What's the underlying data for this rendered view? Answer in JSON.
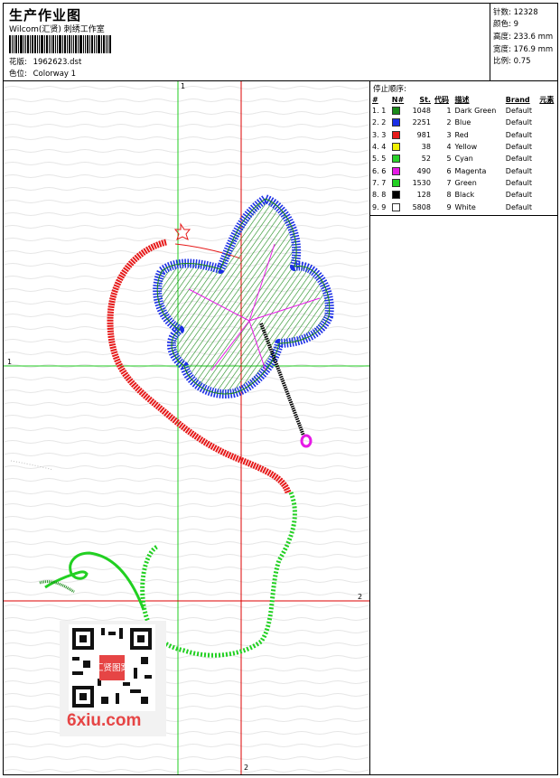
{
  "header": {
    "title": "生产作业图",
    "subtitle": "Wilcom(汇贤) 刺绣工作室",
    "design_label": "花版:",
    "design_value": "1962623.dst",
    "colorway_label": "色位:",
    "colorway_value": "Colorway 1"
  },
  "stats": [
    {
      "label": "针数:",
      "value": "12328"
    },
    {
      "label": "颜色:",
      "value": "9"
    },
    {
      "label": "高度:",
      "value": "233.6 mm"
    },
    {
      "label": "宽度:",
      "value": "176.9 mm"
    },
    {
      "label": "比例:",
      "value": "0.75"
    }
  ],
  "stop_sequence": {
    "title": "停止顺序:",
    "columns": [
      "#",
      "N#",
      "St.",
      "代码",
      "描述",
      "Brand",
      "元素"
    ],
    "rows": [
      {
        "index": "1.",
        "n": "1",
        "color": "#1a8a1a",
        "stitches": "1048",
        "code": "1",
        "desc": "Dark Green",
        "brand": "Default"
      },
      {
        "index": "2.",
        "n": "2",
        "color": "#1a2ee6",
        "stitches": "2251",
        "code": "2",
        "desc": "Blue",
        "brand": "Default"
      },
      {
        "index": "3.",
        "n": "3",
        "color": "#e61a1a",
        "stitches": "981",
        "code": "3",
        "desc": "Red",
        "brand": "Default"
      },
      {
        "index": "4.",
        "n": "4",
        "color": "#f0f000",
        "stitches": "38",
        "code": "4",
        "desc": "Yellow",
        "brand": "Default"
      },
      {
        "index": "5.",
        "n": "5",
        "color": "#2ad22a",
        "stitches": "52",
        "code": "5",
        "desc": "Cyan",
        "brand": "Default"
      },
      {
        "index": "6.",
        "n": "6",
        "color": "#e61ae6",
        "stitches": "490",
        "code": "6",
        "desc": "Magenta",
        "brand": "Default"
      },
      {
        "index": "7.",
        "n": "7",
        "color": "#22d022",
        "stitches": "1530",
        "code": "7",
        "desc": "Green",
        "brand": "Default"
      },
      {
        "index": "8.",
        "n": "8",
        "color": "#000000",
        "stitches": "128",
        "code": "8",
        "desc": "Black",
        "brand": "Default"
      },
      {
        "index": "9.",
        "n": "9",
        "color": "#ffffff",
        "stitches": "5808",
        "code": "9",
        "desc": "White",
        "brand": "Default"
      }
    ]
  },
  "guides": {
    "v1": "1",
    "h1": "1",
    "h2": "2",
    "v2": "2"
  },
  "watermark": {
    "text": "6xiu.com",
    "seal": "汇贤图案"
  },
  "colors": {
    "guide_green": "#22cc22",
    "guide_red": "#dd0000",
    "watermark_red": "#e64545"
  }
}
